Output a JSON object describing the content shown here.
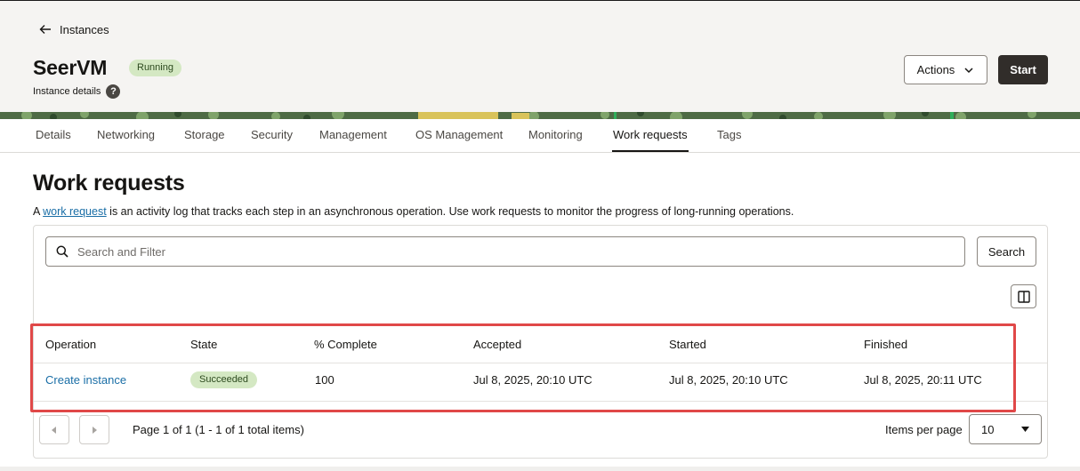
{
  "header": {
    "back_label": "Instances",
    "title": "SeerVM",
    "status_badge": "Running",
    "subtitle": "Instance details",
    "help_icon": "question-circle-icon",
    "actions_label": "Actions",
    "start_label": "Start"
  },
  "tabs": [
    {
      "label": "Details"
    },
    {
      "label": "Networking"
    },
    {
      "label": "Storage"
    },
    {
      "label": "Security"
    },
    {
      "label": "Management"
    },
    {
      "label": "OS Management"
    },
    {
      "label": "Monitoring"
    },
    {
      "label": "Work requests",
      "active": true
    },
    {
      "label": "Tags"
    }
  ],
  "main": {
    "heading": "Work requests",
    "description_prefix": "A ",
    "description_link": "work request",
    "description_suffix": " is an activity log that tracks each step in an asynchronous operation. Use work requests to monitor the progress of long-running operations."
  },
  "search": {
    "placeholder": "Search and Filter",
    "button_label": "Search"
  },
  "table": {
    "columns": [
      "Operation",
      "State",
      "% Complete",
      "Accepted",
      "Started",
      "Finished"
    ],
    "rows": [
      {
        "operation": "Create instance",
        "state": "Succeeded",
        "percent_complete": "100",
        "accepted": "Jul 8, 2025, 20:10 UTC",
        "started": "Jul 8, 2025, 20:10 UTC",
        "finished": "Jul 8, 2025, 20:11 UTC"
      }
    ]
  },
  "pagination": {
    "page_info": "Page 1 of 1 (1 - 1 of 1 total items)",
    "items_per_page_label": "Items per page",
    "items_per_page_value": "10"
  },
  "colors": {
    "accent_link": "#1a6ea6",
    "status_success_bg": "#d4e8c3",
    "primary_button": "#312d2a",
    "highlight": "#e04848"
  }
}
